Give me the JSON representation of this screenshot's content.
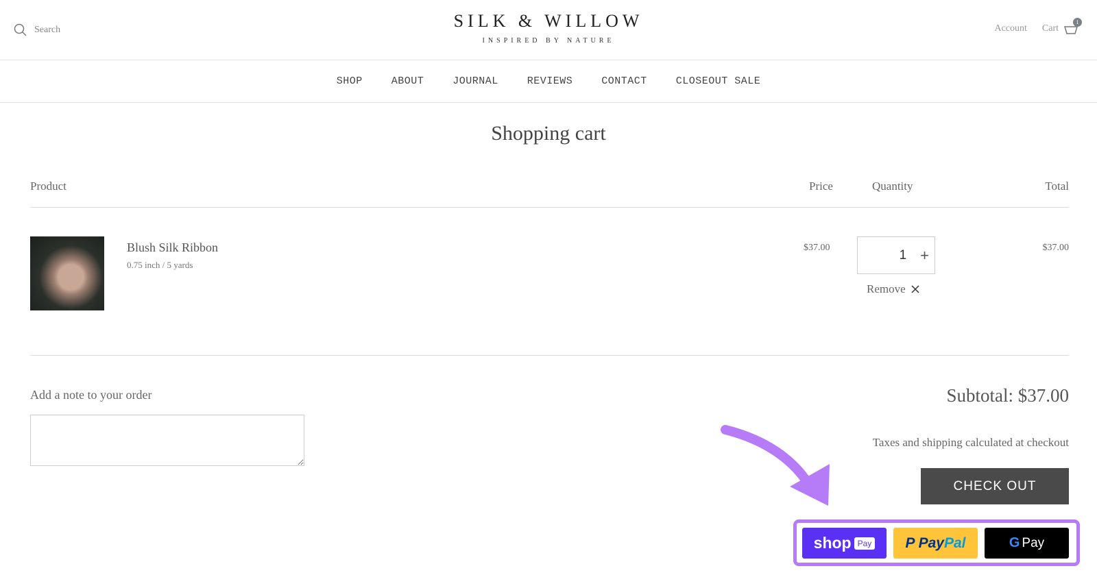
{
  "header": {
    "search_label": "Search",
    "logo_title": "SILK & WILLOW",
    "logo_tagline": "INSPIRED BY NATURE",
    "account_label": "Account",
    "cart_label": "Cart",
    "cart_count": "1"
  },
  "nav": [
    "SHOP",
    "ABOUT",
    "JOURNAL",
    "REVIEWS",
    "CONTACT",
    "CLOSEOUT SALE"
  ],
  "page_title": "Shopping cart",
  "table": {
    "headers": {
      "product": "Product",
      "price": "Price",
      "quantity": "Quantity",
      "total": "Total"
    },
    "items": [
      {
        "name": "Blush Silk Ribbon",
        "variant": "0.75 inch / 5 yards",
        "price": "$37.00",
        "quantity": "1",
        "total": "$37.00",
        "remove_label": "Remove"
      }
    ]
  },
  "note": {
    "label": "Add a note to your order",
    "value": ""
  },
  "summary": {
    "subtotal": "Subtotal: $37.00",
    "taxes_note": "Taxes and shipping calculated at checkout",
    "checkout_label": "CHECK OUT"
  },
  "payments": {
    "shop_pay": "shop",
    "shop_pay_tag": "Pay",
    "paypal": "PayPal",
    "paypal_p": "Pay",
    "paypal_pal": "Pal",
    "gpay": "Pay"
  },
  "colors": {
    "highlight": "#b67cf7",
    "shop_pay": "#5a31f4",
    "paypal": "#ffc439",
    "gpay": "#000000",
    "checkout": "#4a4a4a"
  }
}
